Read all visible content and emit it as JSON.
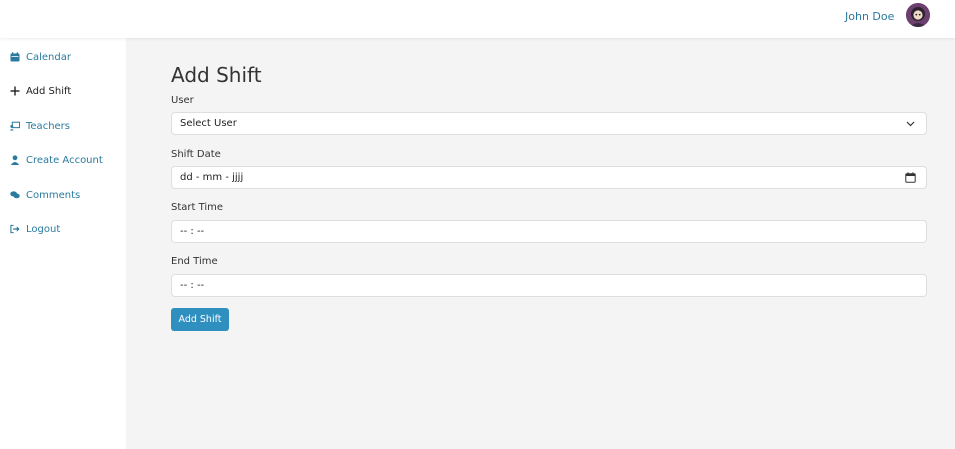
{
  "header": {
    "user_name": "John Doe"
  },
  "sidebar": {
    "items": [
      {
        "label": "Calendar",
        "icon": "calendar-icon"
      },
      {
        "label": "Add Shift",
        "icon": "plus-icon"
      },
      {
        "label": "Teachers",
        "icon": "chalkboard-teacher-icon"
      },
      {
        "label": "Create Account",
        "icon": "user-icon"
      },
      {
        "label": "Comments",
        "icon": "comments-icon"
      },
      {
        "label": "Logout",
        "icon": "sign-out-icon"
      }
    ]
  },
  "main": {
    "title": "Add Shift",
    "form": {
      "user_label": "User",
      "user_value": "Select User",
      "date_label": "Shift Date",
      "date_value": "dd - mm - jjjj",
      "start_label": "Start Time",
      "start_value": "-- : --",
      "end_label": "End Time",
      "end_value": "-- : --",
      "submit_label": "Add Shift"
    }
  },
  "colors": {
    "accent": "#2f8fbf",
    "link": "#2a7a9e",
    "content_bg": "#f4f4f4"
  }
}
